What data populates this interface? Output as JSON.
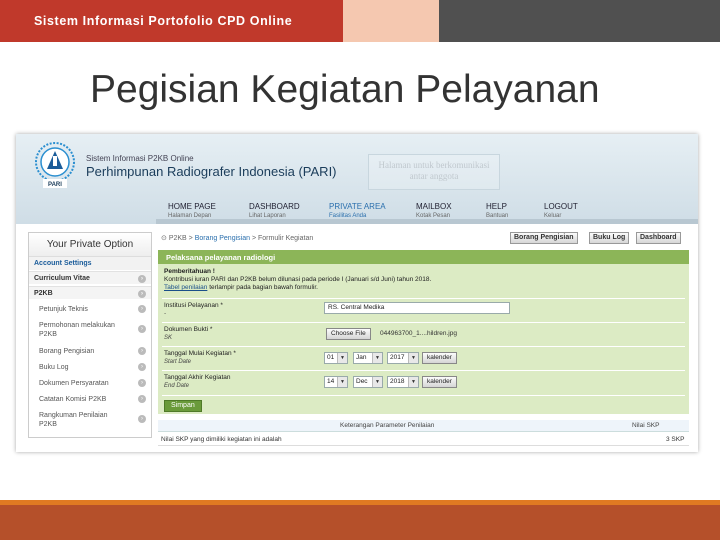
{
  "slide": {
    "band_title": "Sistem Informasi Portofolio CPD Online",
    "title": "Pegisian Kegiatan Pelayanan"
  },
  "site": {
    "logo_text": "PARI",
    "org_small": "Sistem Informasi P2KB Online",
    "org_big": "Perhimpunan Radiografer Indonesia (PARI)",
    "welcome": "Halaman untuk berkomunikasi antar anggota"
  },
  "nav": [
    {
      "label": "HOME PAGE",
      "sub": "Halaman Depan"
    },
    {
      "label": "DASHBOARD",
      "sub": "Lihat Laporan"
    },
    {
      "label": "PRIVATE AREA",
      "sub": "Fasilitas Anda"
    },
    {
      "label": "MAILBOX",
      "sub": "Kotak Pesan"
    },
    {
      "label": "HELP",
      "sub": "Bantuan"
    },
    {
      "label": "LOGOUT",
      "sub": "Keluar"
    }
  ],
  "sidebar": {
    "title": "Your Private Option",
    "account_settings": "Account Settings",
    "curriculum_vitae": "Curriculum Vitae",
    "p2kb": "P2KB",
    "items": [
      "Petunjuk Teknis",
      "Permohonan melakukan P2KB",
      "Borang Pengisian",
      "Buku Log",
      "Dokumen Persyaratan",
      "Catatan Komisi P2KB",
      "Rangkuman Penilaian P2KB"
    ]
  },
  "breadcrumb": {
    "p1": "P2KB",
    "sep1": ">",
    "p2": "Borang Pengisian",
    "sep2": ">",
    "p3": "Formulir Kegiatan"
  },
  "actions": {
    "borang": "Borang Pengisian",
    "bukulog": "Buku Log",
    "dashboard": "Dashboard"
  },
  "form": {
    "header": "Pelaksana pelayanan radiologi",
    "notice_title": "Pemberitahuan !",
    "notice_text": "Kontribusi iuran PARI dan P2KB belum dilunasi pada periode I (Januari s/d Juni) tahun 2018.",
    "notice_link": "Tabel penilaian",
    "notice_text2": "terlampir pada bagian bawah formulir.",
    "institusi_label": "Institusi Pelayanan *",
    "institusi_dash": "-",
    "institusi_value": "RS. Central Medika",
    "dokumen_label": "Dokumen Bukti *",
    "dokumen_sub": "SK",
    "choose_file": "Choose File",
    "file_name": "044963700_1....hildren.jpg",
    "mulai_label": "Tanggal Mulai Kegiatan *",
    "mulai_sub": "Start Date",
    "mulai_day": "01",
    "mulai_month": "Jan",
    "mulai_year": "2017",
    "akhir_label": "Tanggal Akhir Kegiatan",
    "akhir_sub": "End Date",
    "akhir_day": "14",
    "akhir_month": "Dec",
    "akhir_year": "2018",
    "kalender": "kalender",
    "save": "Simpan"
  },
  "table": {
    "col1": "Keterangan Parameter Penilaian",
    "col2": "Nilai SKP",
    "row_label": "Nilai SKP yang dimiliki kegiatan ini adalah",
    "row_value": "3 SKP"
  },
  "colors": {
    "band_red": "#c0392b",
    "band_peach": "#f5c8b0",
    "band_gray": "#505050",
    "panel_green": "#8cb558",
    "panel_bg": "#dcebc4",
    "accent_blue": "#2a6fad",
    "bottom_orange": "#e07a22",
    "bottom_rust": "#b5502a"
  }
}
